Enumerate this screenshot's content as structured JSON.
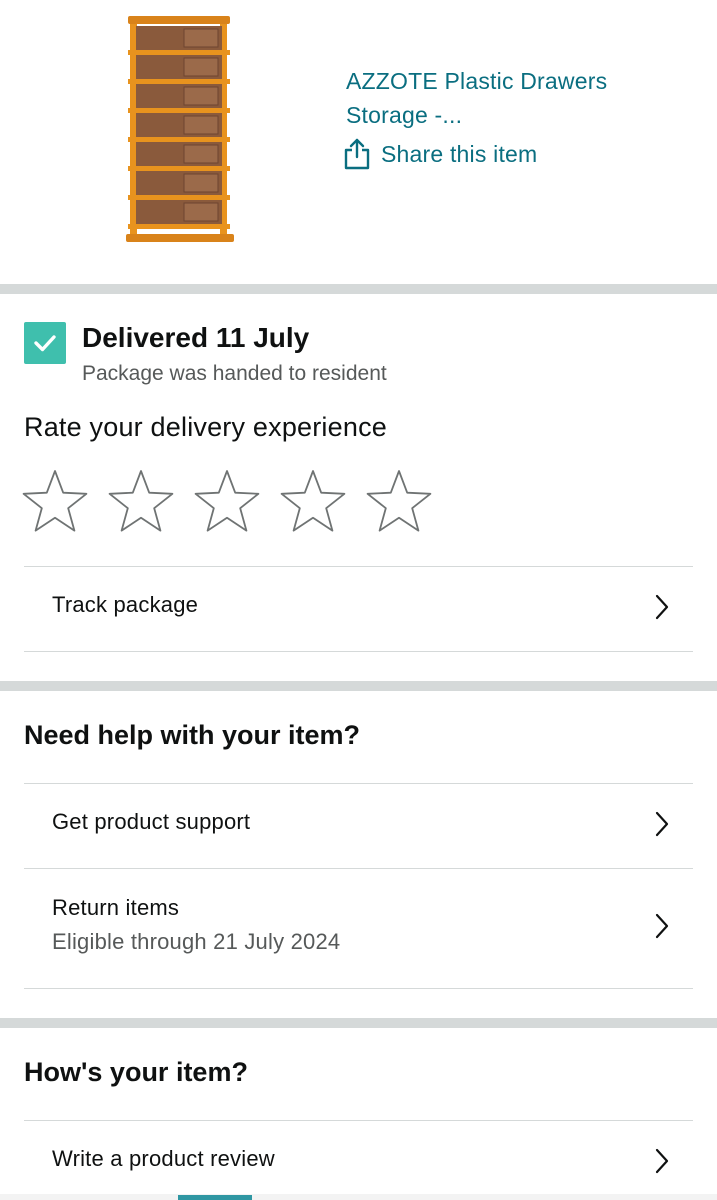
{
  "product": {
    "title_line1": "AZZOTE Plastic Drawers",
    "title_line2": "Storage -...",
    "share_label": "Share this item",
    "icon": "share-icon"
  },
  "delivery": {
    "status": "Delivered 11 July",
    "note": "Package was handed to resident",
    "rate_heading": "Rate your delivery experience",
    "rating_max": 5,
    "rating_value": 0,
    "status_color": "#3fbfad",
    "track_label": "Track package"
  },
  "help": {
    "heading": "Need help with your item?",
    "support_label": "Get product support",
    "return_label": "Return items",
    "return_sub": "Eligible through 21 July 2024"
  },
  "review": {
    "heading": "How's your item?",
    "write_label": "Write a product review"
  },
  "colors": {
    "link": "#0a6e80",
    "check": "#3fbfad",
    "separator": "#d5d9d9"
  }
}
